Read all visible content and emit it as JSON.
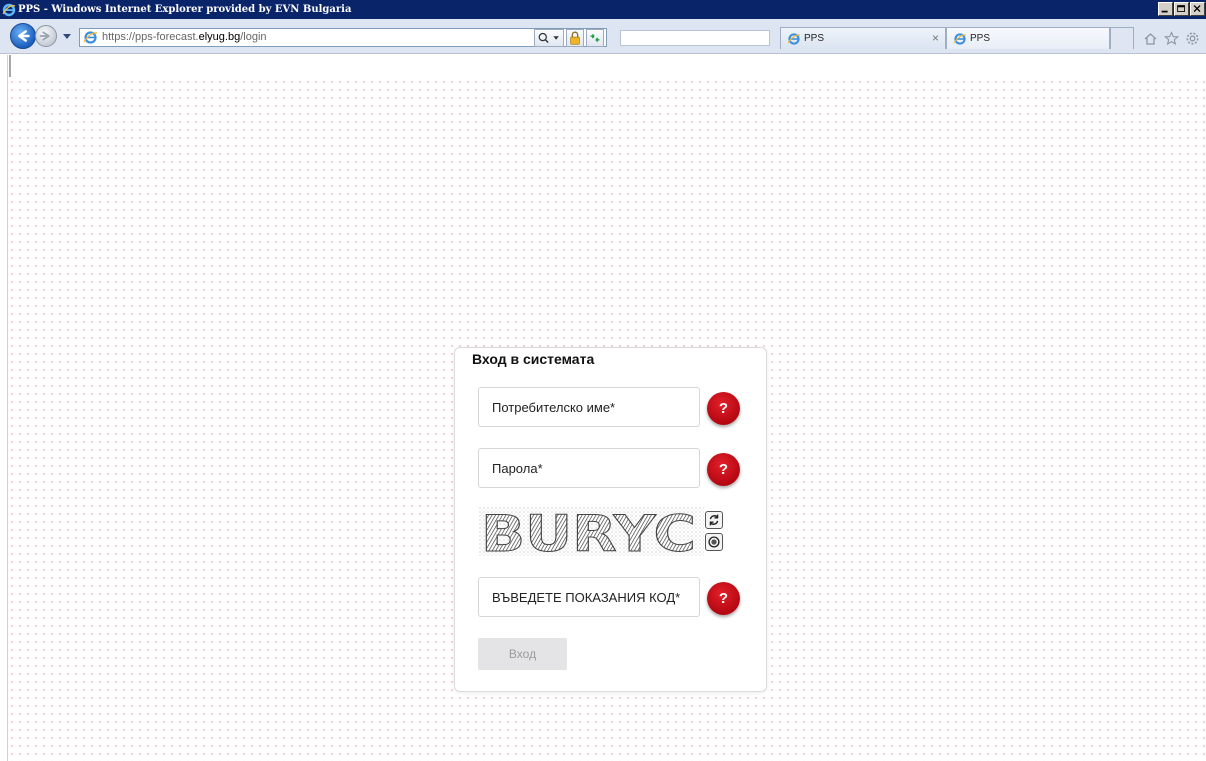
{
  "window": {
    "title": "PPS - Windows Internet Explorer provided by EVN Bulgaria"
  },
  "addressbar": {
    "url_prefix": "https://pps-forecast.",
    "url_domain": "elyug.bg",
    "url_suffix": "/login"
  },
  "tabs": [
    {
      "label": "PPS",
      "close": "×"
    },
    {
      "label": "PPS"
    }
  ],
  "login": {
    "title": "Вход в системата",
    "username_placeholder": "Потребителско име*",
    "password_placeholder": "Парола*",
    "code_placeholder": "ВЪВЕДЕТЕ ПОКАЗАНИЯ КОД*",
    "help_label": "?",
    "captcha_text": "BURYC",
    "submit_label": "Вход"
  },
  "colors": {
    "titlebar": "#0a246a",
    "help_button": "#c8101a",
    "page_dots": "#f7cfd9",
    "disabled_button": "#e4e4e6"
  },
  "icons": {
    "browser": "ie-logo-icon",
    "back": "back-arrow-icon",
    "forward": "forward-arrow-icon",
    "search": "search-icon",
    "lock": "lock-icon",
    "refresh": "refresh-icon",
    "home": "home-icon",
    "favorites": "star-icon",
    "tools": "gear-icon",
    "captcha_refresh": "refresh-captcha-icon",
    "captcha_audio": "audio-captcha-icon"
  }
}
